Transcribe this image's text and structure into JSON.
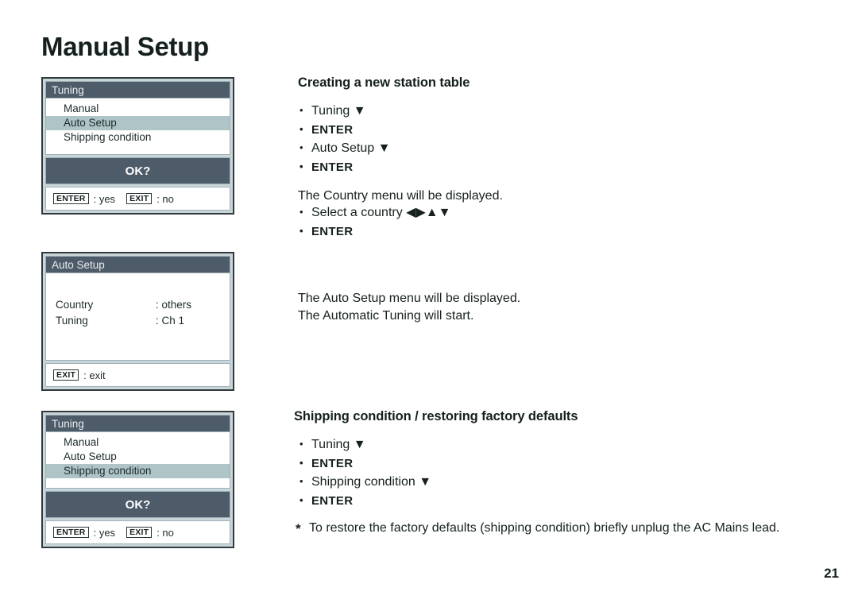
{
  "page": {
    "title": "Manual Setup",
    "number": "21"
  },
  "panels": {
    "tuning_auto": {
      "titlebar": "Tuning",
      "rows": [
        {
          "label": "Manual",
          "selected": false
        },
        {
          "label": "Auto Setup",
          "selected": true
        },
        {
          "label": "Shipping condition",
          "selected": false
        },
        {
          "label": "",
          "selected": false
        }
      ],
      "ok_label": "OK?",
      "footer": [
        {
          "key": "ENTER",
          "hint": ": yes"
        },
        {
          "key": "EXIT",
          "hint": ": no"
        }
      ]
    },
    "auto_setup": {
      "titlebar": "Auto Setup",
      "entries": [
        {
          "key": "Country",
          "value": ": others"
        },
        {
          "key": "Tuning",
          "value": ": Ch 1"
        }
      ],
      "footer": [
        {
          "key": "EXIT",
          "hint": ": exit"
        }
      ]
    },
    "tuning_shipping": {
      "titlebar": "Tuning",
      "rows": [
        {
          "label": "Manual",
          "selected": false
        },
        {
          "label": "Auto Setup",
          "selected": false
        },
        {
          "label": "Shipping condition",
          "selected": true
        },
        {
          "label": "",
          "selected": false
        }
      ],
      "ok_label": "OK?",
      "footer": [
        {
          "key": "ENTER",
          "hint": ": yes"
        },
        {
          "key": "EXIT",
          "hint": ": no"
        }
      ]
    }
  },
  "sections": {
    "creating": {
      "heading": "Creating a new station table",
      "steps_1": [
        {
          "text": "Tuning ▼",
          "bold": false
        },
        {
          "text": "ENTER",
          "bold": true
        },
        {
          "text": "Auto Setup ▼",
          "bold": false
        },
        {
          "text": "ENTER",
          "bold": true
        }
      ],
      "note_country": "The Country menu will be displayed.",
      "steps_2": [
        {
          "text": "Select a country ◀▶▲▼",
          "bold": false
        },
        {
          "text": "ENTER",
          "bold": true
        }
      ],
      "result_line_1": "The Auto Setup menu will be displayed.",
      "result_line_2": "The Automatic Tuning will start."
    },
    "shipping": {
      "heading": "Shipping condition / restoring factory defaults",
      "steps": [
        {
          "text": "Tuning ▼",
          "bold": false
        },
        {
          "text": "ENTER",
          "bold": true
        },
        {
          "text": "Shipping condition ▼",
          "bold": false
        },
        {
          "text": "ENTER",
          "bold": true
        }
      ],
      "footnote": "To restore the factory defaults (shipping condition) briefly unplug the AC Mains lead."
    }
  },
  "colors": {
    "titlebar_bg": "#4e5b68",
    "highlight_row": "#aec4c6",
    "panel_frame": "#333a3d",
    "panel_inner": "#c9d6d9"
  }
}
